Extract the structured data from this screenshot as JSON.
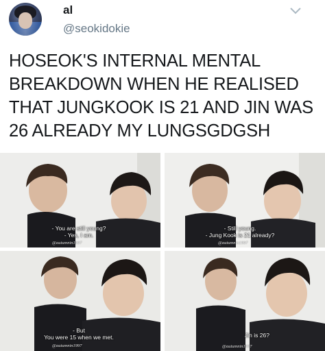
{
  "tweet": {
    "display_name": "al",
    "handle": "@seokidokie",
    "text": "HOSEOK'S INTERNAL MENTAL\nBREAKDOWN WHEN HE REALISED\nTHAT JUNGKOOK IS 21 AND JIN WAS\n26 ALREADY MY LUNGSGDGSH",
    "avatar_icon": "profile-avatar",
    "menu_icon": "chevron-down-icon"
  },
  "panels": [
    {
      "subtitle_1": "- You are still young?",
      "subtitle_2": "- Yes, I am.",
      "watermark": "@autumnin1997"
    },
    {
      "subtitle_1": "- Still young.",
      "subtitle_2": "- Jung Kook is 21 already?",
      "watermark": "@autumnin1997"
    },
    {
      "subtitle_1": "- But",
      "subtitle_2": "You were 15 when we met.",
      "watermark": "@autumnin1997"
    },
    {
      "subtitle_1": "Jin is 26?",
      "watermark": "@autumnin1997"
    }
  ],
  "colors": {
    "text": "#14171a",
    "secondary": "#657786",
    "background": "#ffffff"
  }
}
